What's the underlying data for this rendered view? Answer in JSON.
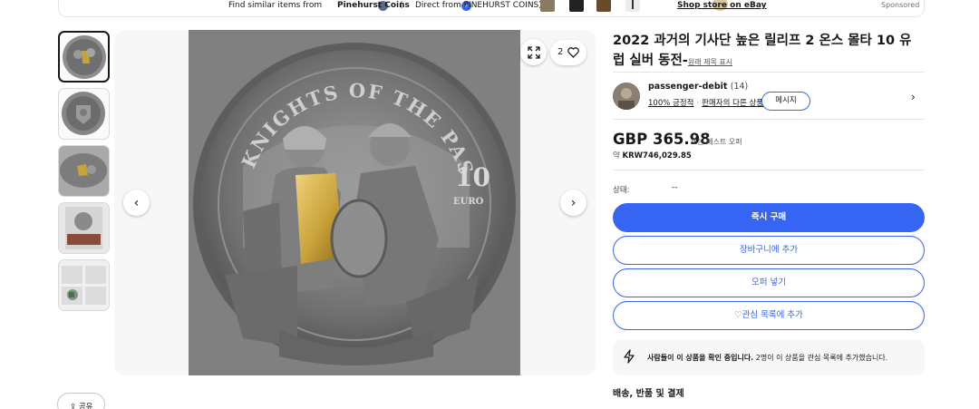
{
  "banner": {
    "find_similar": "Find similar items from",
    "store_name": "Pinehurst Coins",
    "direct_from": "Direct from PINEHURST COINS)",
    "open_paren": "(",
    "shop_store": "Shop store on eBay",
    "sponsored": "Sponsored"
  },
  "gallery": {
    "thumbnail_count": 5,
    "active_index": 0,
    "favorite_count": "2"
  },
  "share_label": "공유",
  "listing": {
    "title": "2022 과거의 기사단 높은 릴리프 2 온스 몰타 10 유럽 실버 동전-",
    "original_title_link": "원래 제목 표시"
  },
  "seller": {
    "name": "passenger-debit",
    "feedback_count": "(14)",
    "positive": "100% 긍정적",
    "other_items": "판매자의 다른 상품",
    "message_button": "메시지"
  },
  "price": {
    "main": "GBP 365.98",
    "best_offer": "또는 베스트 오퍼",
    "approx_prefix": "약",
    "krw": "KRW746,029.85"
  },
  "condition": {
    "label": "상태:",
    "value": "--"
  },
  "buttons": {
    "buy_now": "즉시 구매",
    "add_to_cart": "장바구니에 추가",
    "make_offer": "오퍼 넣기",
    "add_watchlist": "관심 목록에 추가"
  },
  "notice": {
    "bold": "사람들이 이 상품을 확인 중입니다.",
    "rest": " 2명이 이 상품을 관심 목록에 추가했습니다."
  },
  "shipping_title": "배송, 반품 및 결제",
  "colors": {
    "primary": "#3665f3",
    "text": "#191919",
    "gold": "#c9a23a"
  }
}
